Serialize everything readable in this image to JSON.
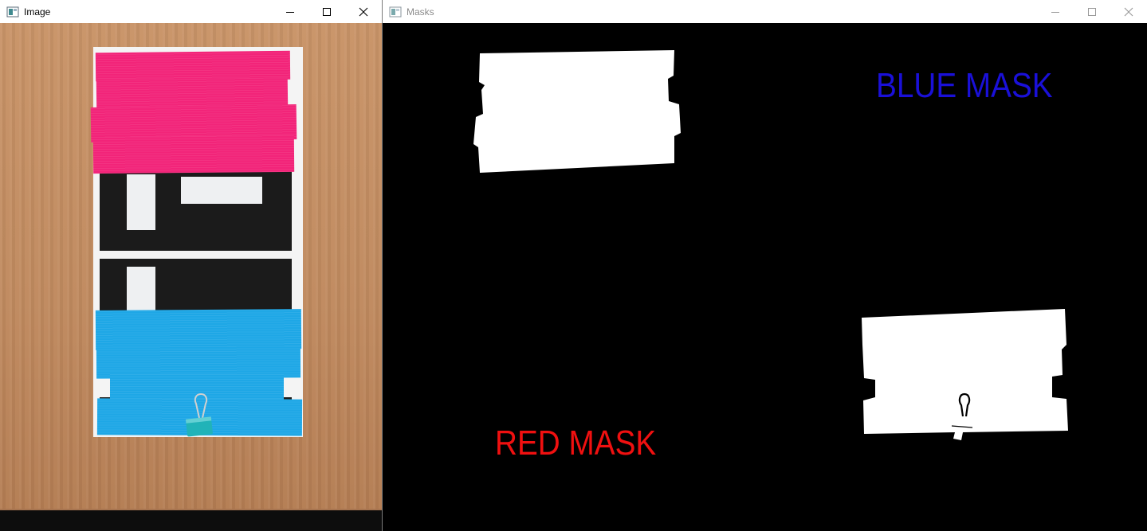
{
  "image_window": {
    "title": "Image",
    "icon": "opencv-window-icon",
    "controls": [
      "minimize-icon",
      "maximize-icon",
      "close-icon"
    ]
  },
  "masks_window": {
    "title": "Masks",
    "icon": "opencv-window-icon",
    "controls": [
      "minimize-icon",
      "maximize-icon",
      "close-icon"
    ],
    "blue_mask_label": "BLUE MASK",
    "red_mask_label": "RED MASK"
  },
  "colors": {
    "pink_tape": "#f22479",
    "blue_tape": "#1ea7e6",
    "mask_background": "#000000",
    "mask_foreground": "#ffffff",
    "blue_label": "#1a10d8",
    "red_label": "#f01010"
  }
}
